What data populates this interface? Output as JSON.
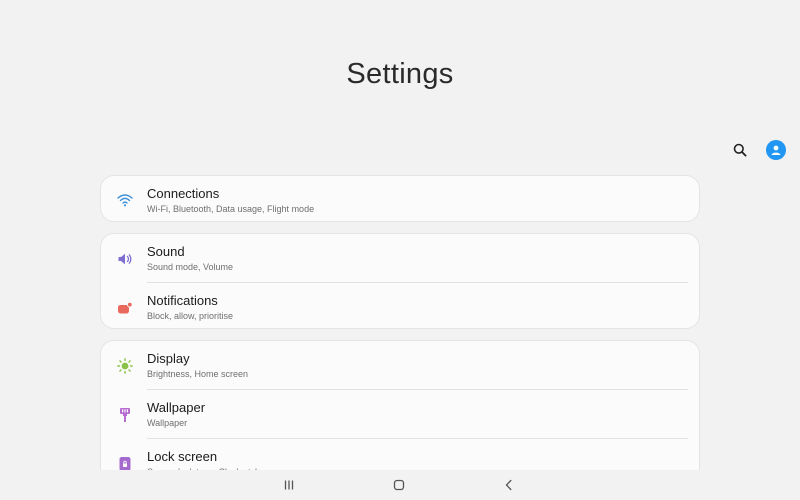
{
  "header": {
    "title": "Settings"
  },
  "top_actions": {
    "search_icon": "search-icon",
    "profile_icon": "account-icon"
  },
  "groups": [
    {
      "items": [
        {
          "label": "Connections",
          "subtitle": "Wi-Fi, Bluetooth, Data usage, Flight mode",
          "icon": "wifi-icon",
          "icon_color": "#3d8fd6"
        }
      ]
    },
    {
      "items": [
        {
          "label": "Sound",
          "subtitle": "Sound mode, Volume",
          "icon": "speaker-icon",
          "icon_color": "#7f6fd0"
        },
        {
          "label": "Notifications",
          "subtitle": "Block, allow, prioritise",
          "icon": "notification-icon",
          "icon_color": "#e86a5c"
        }
      ]
    },
    {
      "items": [
        {
          "label": "Display",
          "subtitle": "Brightness, Home screen",
          "icon": "brightness-icon",
          "icon_color": "#8bc34a"
        },
        {
          "label": "Wallpaper",
          "subtitle": "Wallpaper",
          "icon": "wallpaper-icon",
          "icon_color": "#b86bd3"
        },
        {
          "label": "Lock screen",
          "subtitle": "Screen lock type, Clock style",
          "icon": "lock-icon",
          "icon_color": "#a56ad0"
        }
      ]
    }
  ],
  "navbar": {
    "recents_icon": "recents-icon",
    "home_icon": "home-icon",
    "back_icon": "back-icon"
  },
  "colors": {
    "background": "#f2f2f2",
    "card": "#fbfbfb",
    "accent": "#2196f3"
  }
}
